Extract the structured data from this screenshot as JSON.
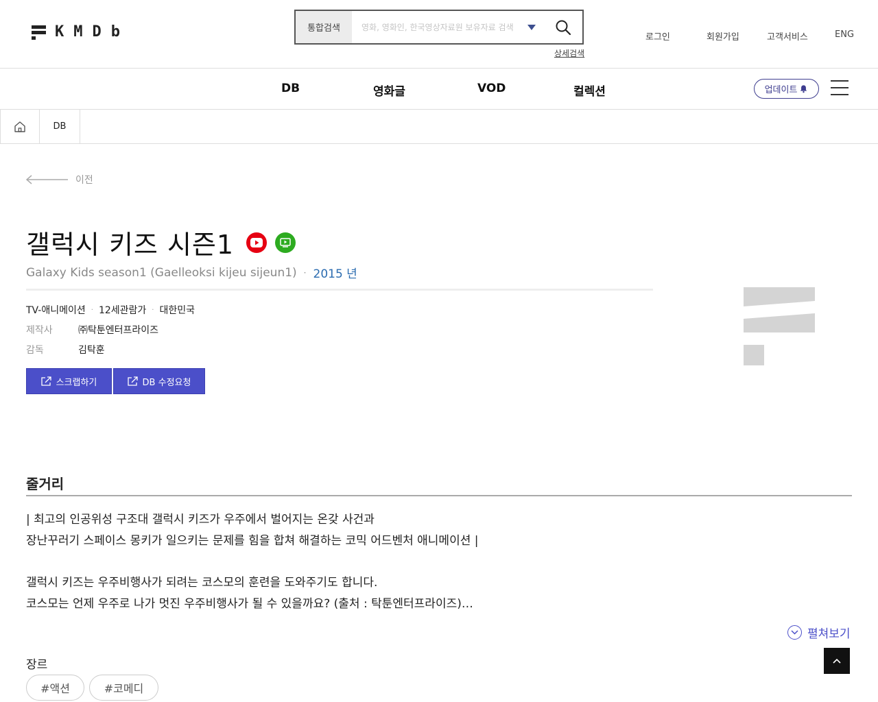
{
  "header": {
    "logo_text": "KMDb",
    "search": {
      "scope_label": "통합검색",
      "placeholder": "영화, 영화인, 한국영상자료원 보유자료 검색",
      "advanced_label": "상세검색"
    },
    "util_links": [
      "로그인",
      "회원가입",
      "고객서비스",
      "ENG"
    ]
  },
  "gnb": {
    "items": [
      "DB",
      "영화글",
      "VOD",
      "컬렉션"
    ],
    "update_label": "업데이트"
  },
  "breadcrumb": {
    "current": "DB"
  },
  "detail": {
    "back_label": "이전",
    "title": "갤럭시 키즈 시즌1",
    "subtitle": "Galaxy Kids season1 (Gaelleoksi kijeu sijeun1)",
    "year": "2015 년",
    "meta": [
      "TV-애니메이션",
      "12세관람가",
      "대한민국"
    ],
    "info": [
      {
        "label": "제작사",
        "value": "㈜탁툰엔터프라이즈"
      },
      {
        "label": "감독",
        "value": "김탁훈"
      }
    ],
    "actions": {
      "scrap_label": "스크랩하기",
      "edit_label": "DB 수정요청"
    }
  },
  "synopsis": {
    "heading": "줄거리",
    "lines": [
      "| 최고의 인공위성 구조대 갤럭시 키즈가 우주에서 벌어지는 온갖 사건과",
      "장난꾸러기 스페이스 몽키가 일으키는 문제를 힘을 합쳐 해결하는 코믹 어드벤처 애니메이션 |",
      "",
      "갤럭시 키즈는 우주비행사가 되려는 코스모의 훈련을 도와주기도 합니다.",
      "코스모는 언제 우주로 나가 멋진 우주비행사가 될 수 있을까요? (출처 : 탁툰엔터프라이즈)…"
    ],
    "expand_label": "펼쳐보기"
  },
  "genre": {
    "heading": "장르",
    "tags": [
      "#액션",
      "#코메디"
    ]
  },
  "colors": {
    "accent": "#4b4fc9",
    "year": "#2b6cb0",
    "youtube": "#e60012",
    "vod": "#2dab20"
  }
}
